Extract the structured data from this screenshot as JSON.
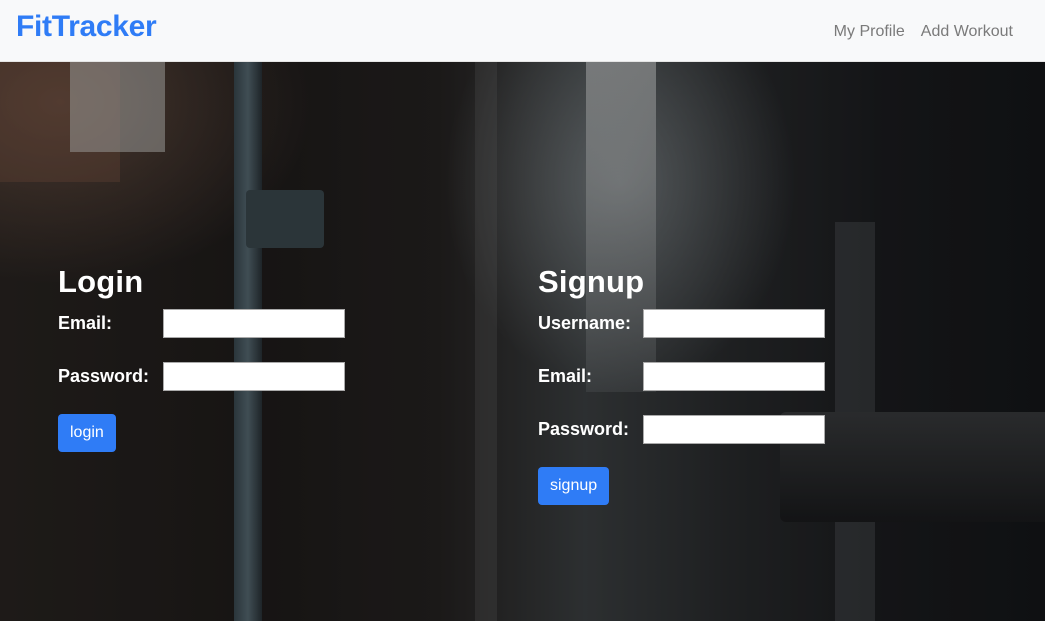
{
  "nav": {
    "brand": "FitTracker",
    "links": [
      "My Profile",
      "Add Workout"
    ]
  },
  "login": {
    "title": "Login",
    "email_label": "Email:",
    "password_label": "Password:",
    "button": "login"
  },
  "signup": {
    "title": "Signup",
    "username_label": "Username:",
    "email_label": "Email:",
    "password_label": "Password:",
    "button": "signup"
  },
  "colors": {
    "accent": "#2f7cf6",
    "navbar_bg": "#f8f9fa",
    "nav_link": "#7a7a7a"
  }
}
